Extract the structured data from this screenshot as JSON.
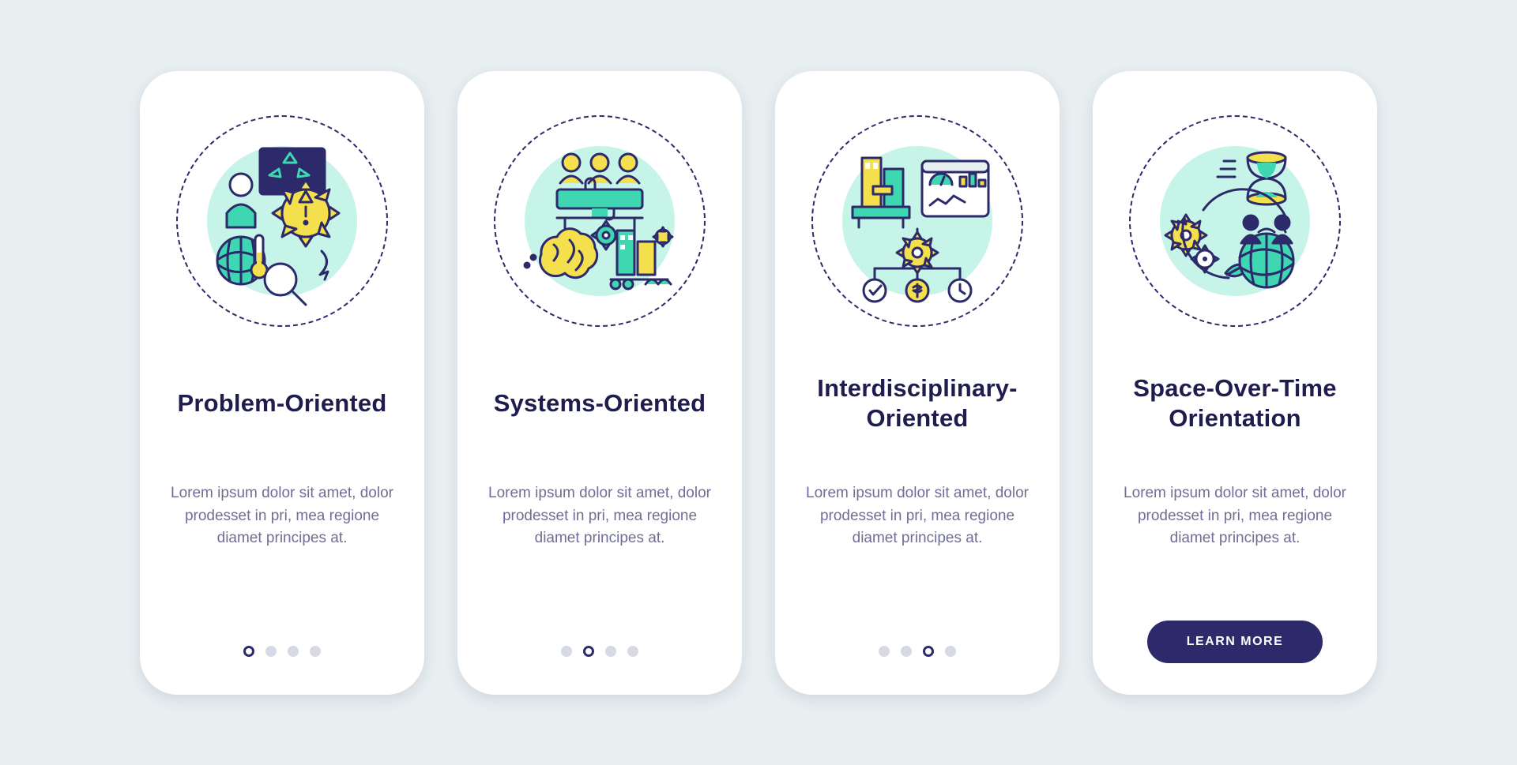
{
  "cards": [
    {
      "icon": "problem-oriented-icon",
      "title": "Problem-Oriented",
      "desc": "Lorem ipsum dolor sit amet, dolor prodesset in pri, mea regione diamet principes at.",
      "activeDot": 0,
      "totalDots": 4,
      "cta": null
    },
    {
      "icon": "systems-oriented-icon",
      "title": "Systems-Oriented",
      "desc": "Lorem ipsum dolor sit amet, dolor prodesset in pri, mea regione diamet principes at.",
      "activeDot": 1,
      "totalDots": 4,
      "cta": null
    },
    {
      "icon": "interdisciplinary-oriented-icon",
      "title": "Interdisciplinary-Oriented",
      "desc": "Lorem ipsum dolor sit amet, dolor prodesset in pri, mea regione diamet principes at.",
      "activeDot": 2,
      "totalDots": 4,
      "cta": null
    },
    {
      "icon": "space-over-time-icon",
      "title": "Space-Over-Time Orientation",
      "desc": "Lorem ipsum dolor sit amet, dolor prodesset in pri, mea regione diamet principes at.",
      "activeDot": null,
      "totalDots": 0,
      "cta": "LEARN MORE"
    }
  ],
  "palette": {
    "navy": "#2c2a6b",
    "teal": "#3fd6b2",
    "tealLight": "#c7f4e8",
    "yellow": "#f4e04d",
    "pageBg": "#e8eff1"
  }
}
